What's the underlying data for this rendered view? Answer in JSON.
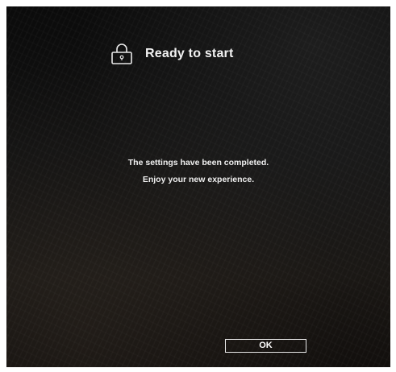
{
  "dialog": {
    "title": "Ready to start",
    "icon": "lock-icon",
    "message_line1": "The settings have been completed.",
    "message_line2": "Enjoy your new experience.",
    "ok_label": "OK"
  },
  "colors": {
    "background": "#0f0f0f",
    "text": "#f2f2f2",
    "button_border": "#e8e8e8"
  }
}
